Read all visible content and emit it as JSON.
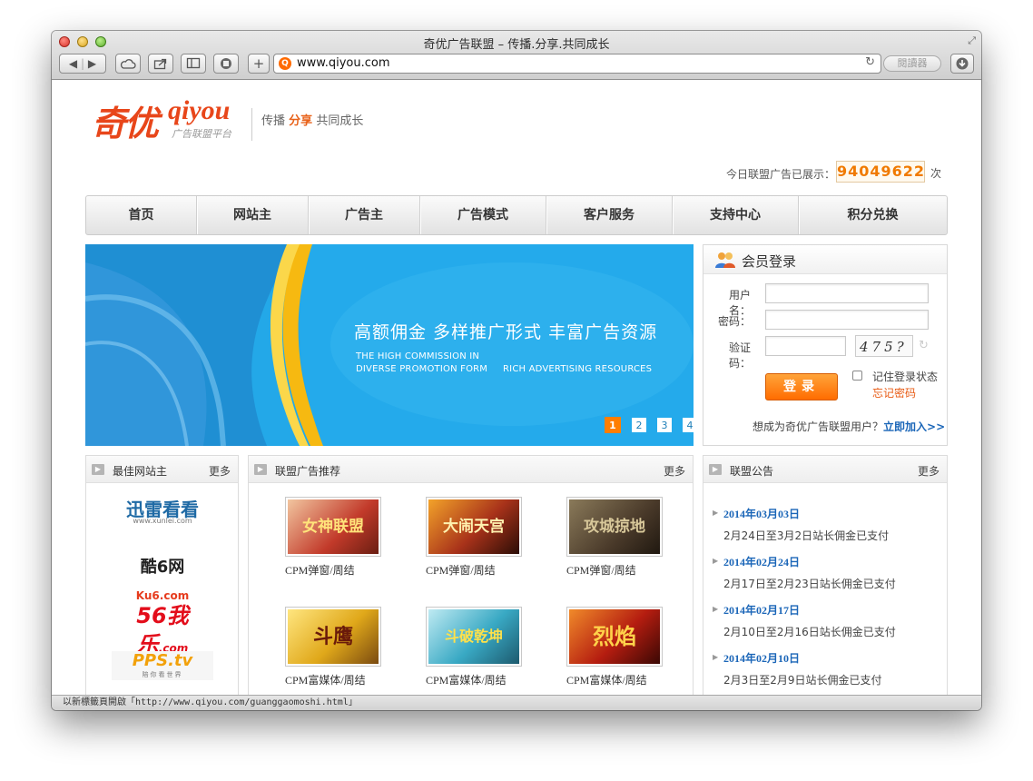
{
  "window": {
    "title": "奇优广告联盟 – 传播.分享.共同成长"
  },
  "toolbar": {
    "url": "www.qiyou.com",
    "reader_label": "閱讀器",
    "back_icon": "back-arrow-icon",
    "forward_icon": "forward-arrow-icon"
  },
  "header": {
    "logo_cn": "奇优",
    "logo_en": "qiyou",
    "logo_sub": "广告联盟平台",
    "slogan_1": "传播",
    "slogan_2": "分享",
    "slogan_3": "共同成长",
    "counter_label": "今日联盟广告已展示：",
    "counter_value": "94049622",
    "counter_unit": "次"
  },
  "nav": {
    "items": [
      {
        "label": "首页"
      },
      {
        "label": "网站主"
      },
      {
        "label": "广告主"
      },
      {
        "label": "广告模式"
      },
      {
        "label": "客户服务"
      },
      {
        "label": "支持中心"
      },
      {
        "label": "积分兑换"
      }
    ]
  },
  "banner": {
    "title_cn": "高额佣金  多样推广形式  丰富广告资源",
    "line_en_1": "THE HIGH COMMISSION IN",
    "line_en_2": "DIVERSE PROMOTION FORM     RICH ADVERTISING RESOURCES",
    "pages": [
      "1",
      "2",
      "3",
      "4"
    ],
    "active_page": "1"
  },
  "login": {
    "title": "会员登录",
    "username_label": "用户名：",
    "password_label": "密码：",
    "captcha_label": "验证码：",
    "captcha_text": "475?",
    "submit_label": "登录",
    "remember_label": "记住登录状态",
    "forgot_label": "忘记密码",
    "join_question": "想成为奇优广告联盟用户？",
    "join_link": "立即加入>>"
  },
  "best_sites": {
    "title": "最佳网站主",
    "more": "更多",
    "sites": [
      {
        "name": "迅雷看看",
        "sub": "www.xunlei.com"
      },
      {
        "name": "酷6网",
        "sub": "Ku6.com"
      },
      {
        "name": "56我乐",
        "sub": ".com"
      },
      {
        "name": "PPS.tv",
        "sub": "陪你看世界"
      }
    ]
  },
  "ads": {
    "title": "联盟广告推荐",
    "more": "更多",
    "items": [
      {
        "art": "女神联盟",
        "caption": "CPM弹窗/周结",
        "color": "#c23a2a"
      },
      {
        "art": "大闹天宫",
        "caption": "CPM弹窗/周结",
        "color": "#a8321a"
      },
      {
        "art": "攻城掠地",
        "caption": "CPM弹窗/周结",
        "color": "#4a3a2a"
      },
      {
        "art": "斗鹰",
        "caption": "CPM富媒体/周结",
        "color": "#e0a81a"
      },
      {
        "art": "斗破乾坤",
        "caption": "CPM富媒体/周结",
        "color": "#39a9c4"
      },
      {
        "art": "烈焰",
        "caption": "CPM富媒体/周结",
        "color": "#b51d10"
      }
    ]
  },
  "notices": {
    "title": "联盟公告",
    "more": "更多",
    "items": [
      {
        "date": "2014年03月03日",
        "text": "2月24日至3月2日站长佣金已支付"
      },
      {
        "date": "2014年02月24日",
        "text": "2月17日至2月23日站长佣金已支付"
      },
      {
        "date": "2014年02月17日",
        "text": "2月10日至2月16日站长佣金已支付"
      },
      {
        "date": "2014年02月10日",
        "text": "2月3日至2月9日站长佣金已支付"
      }
    ]
  },
  "statusbar": {
    "text": "以新標籤頁開啟「http://www.qiyou.com/guanggaomoshi.html」"
  }
}
